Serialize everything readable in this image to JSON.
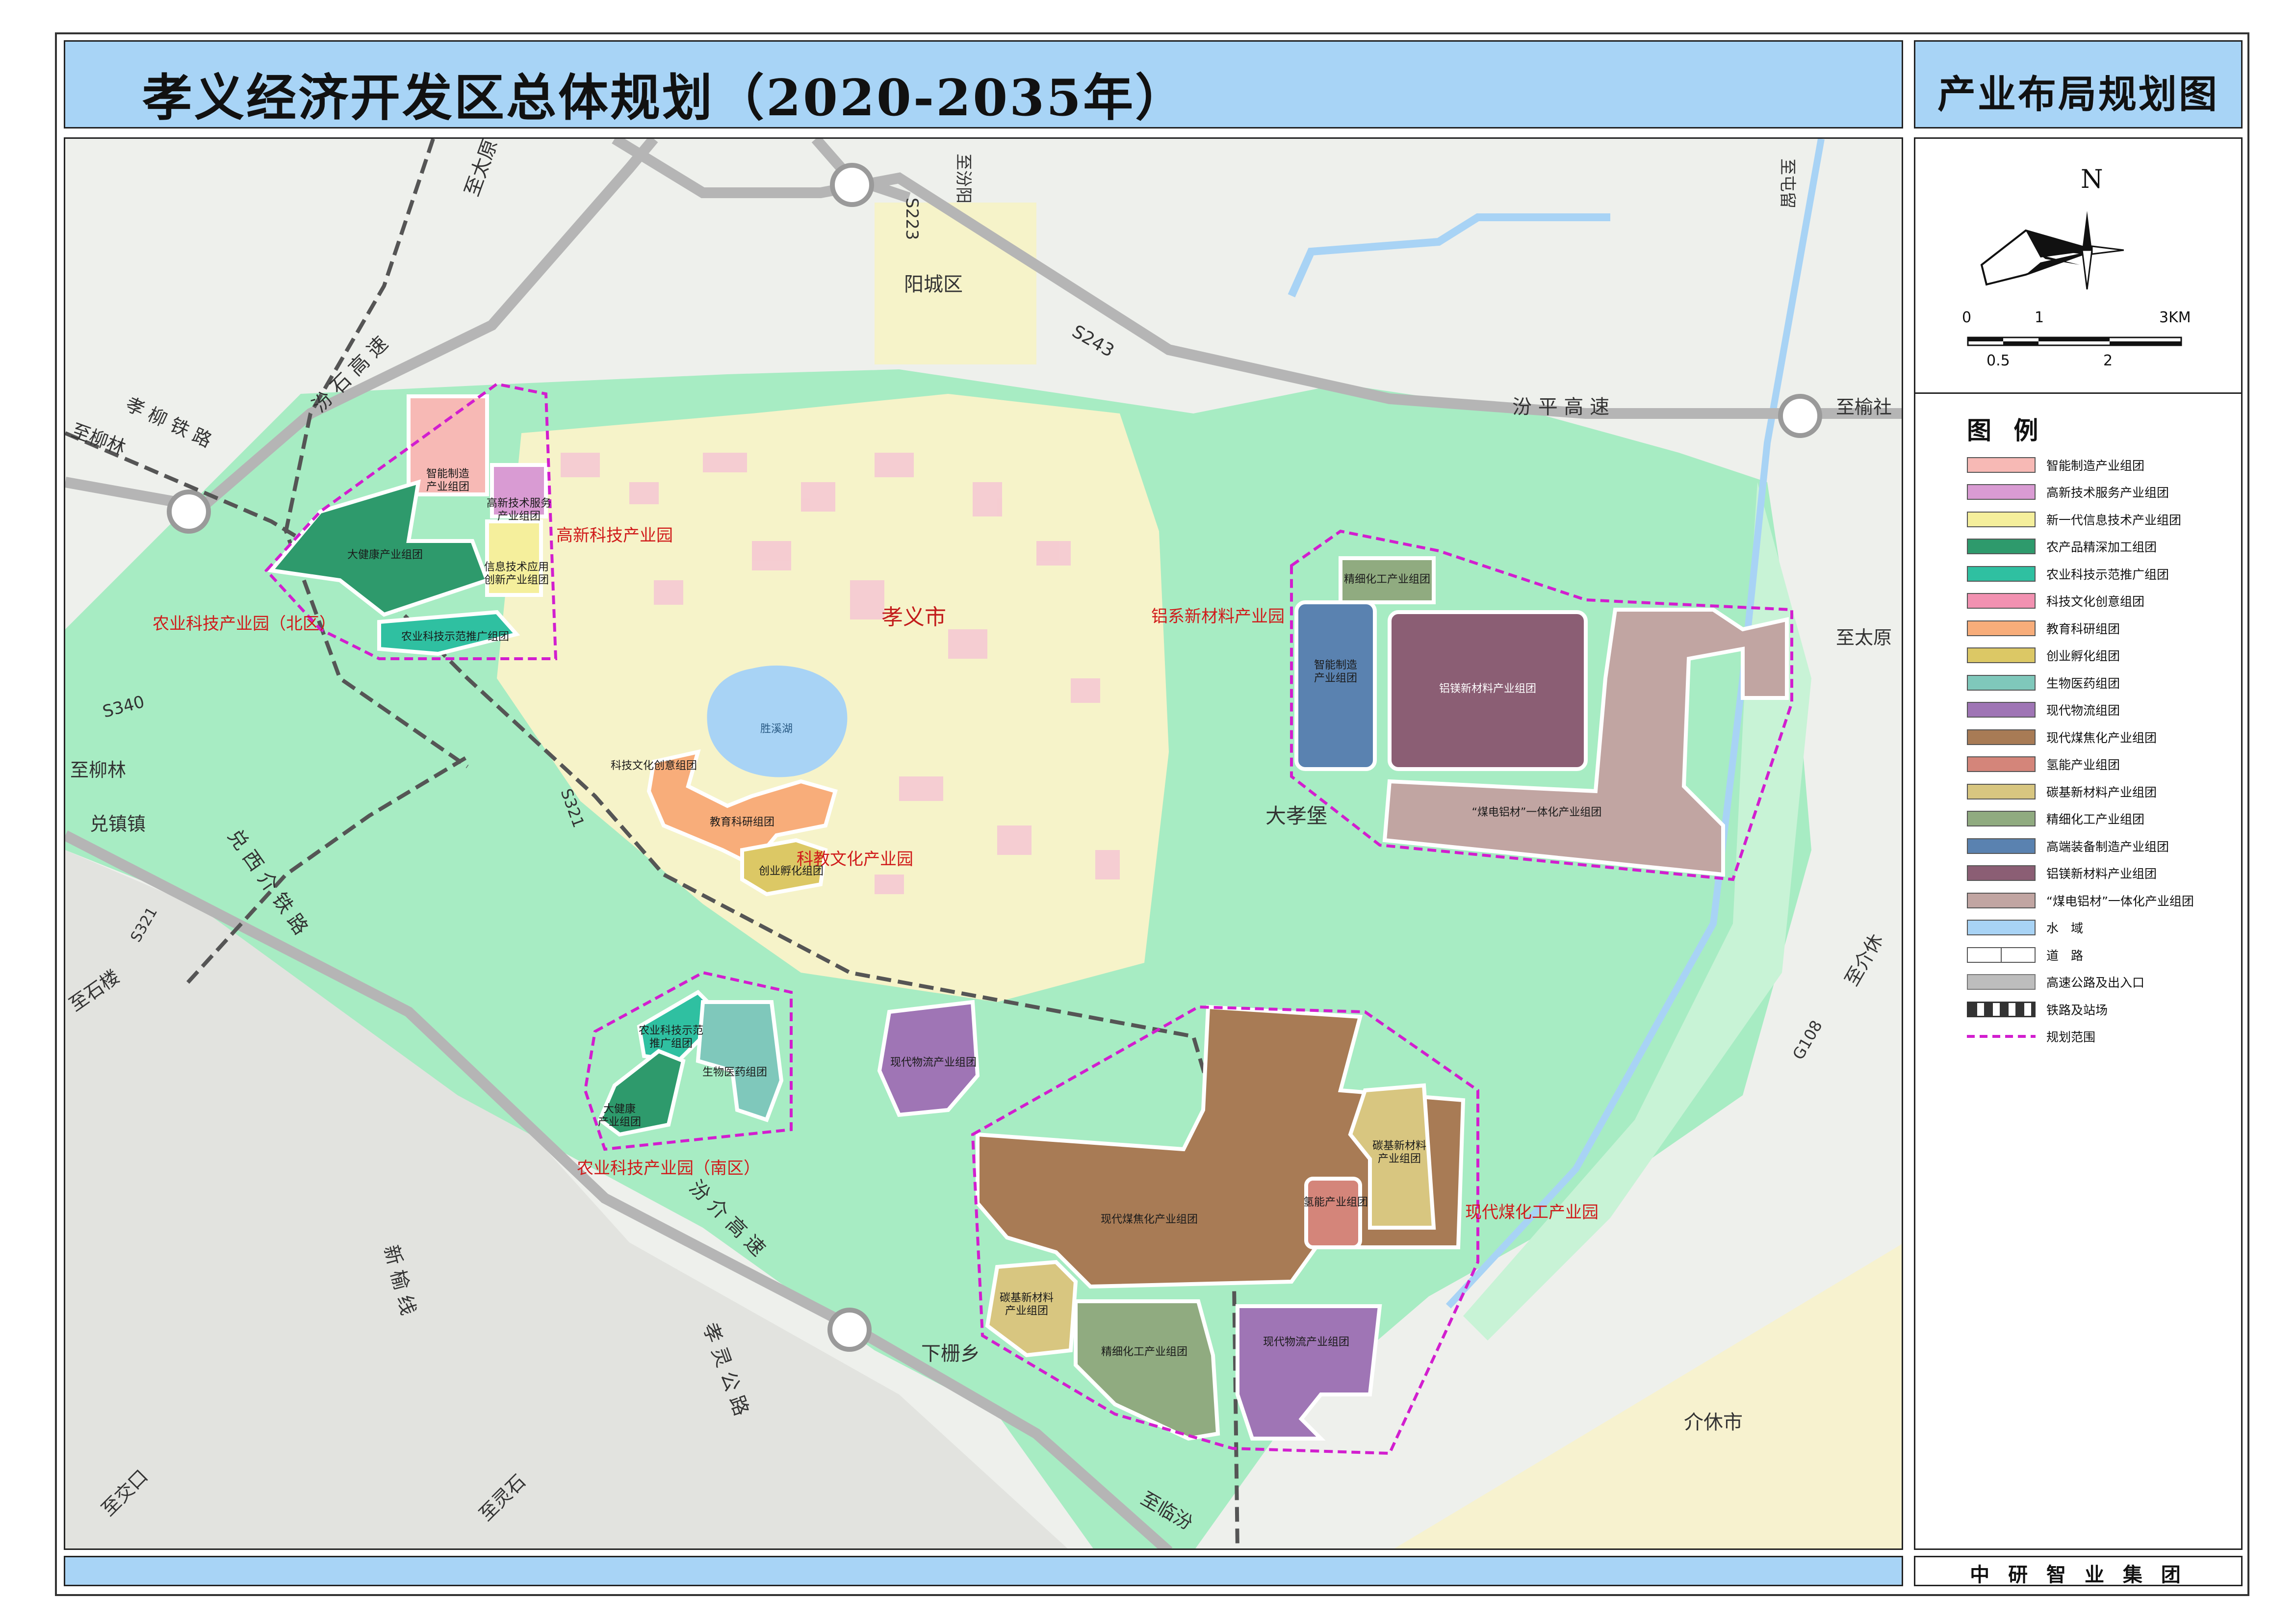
{
  "title": "孝义经济开发区总体规划（2020-2035年）",
  "sheet_title": "产业布局规划图",
  "organization": "中 研 智 业 集 团",
  "compass": {
    "north_label": "N"
  },
  "scale_bar": {
    "top_labels": [
      "0",
      "1",
      "3KM"
    ],
    "bottom_labels": [
      "0.5",
      "2"
    ]
  },
  "legend": {
    "title": "图 例",
    "items": [
      {
        "label": "智能制造产业组团",
        "color": "#f7b9b5"
      },
      {
        "label": "高新技术服务产业组团",
        "color": "#d99bd3"
      },
      {
        "label": "新一代信息技术产业组团",
        "color": "#f5ef9c"
      },
      {
        "label": "农产品精深加工组团",
        "color": "#2e9a6c"
      },
      {
        "label": "农业科技示范推广组团",
        "color": "#2fc0a1"
      },
      {
        "label": "科技文化创意组团",
        "color": "#f291b1"
      },
      {
        "label": "教育科研组团",
        "color": "#f8ad7a"
      },
      {
        "label": "创业孵化组团",
        "color": "#dcc865"
      },
      {
        "label": "生物医药组团",
        "color": "#7fc8bb"
      },
      {
        "label": "现代物流组团",
        "color": "#9f75b5"
      },
      {
        "label": "现代煤焦化产业组团",
        "color": "#a87b55"
      },
      {
        "label": "氢能产业组团",
        "color": "#d4857a"
      },
      {
        "label": "碳基新材料产业组团",
        "color": "#d8c680"
      },
      {
        "label": "精细化工产业组团",
        "color": "#90ab80"
      },
      {
        "label": "高端装备制造产业组团",
        "color": "#5a82b0"
      },
      {
        "label": "铝镁新材料产业组团",
        "color": "#8b5e74"
      },
      {
        "label": "“煤电铝材”一体化产业组团",
        "color": "#c1a5a2"
      },
      {
        "label": "水　域",
        "color": "#a8d3f5"
      },
      {
        "label": "道　路",
        "color": "#ffffff"
      },
      {
        "label": "高速公路及出入口",
        "color": "#bdbdbd"
      },
      {
        "label": "铁路及站场",
        "color": "#ffffff"
      },
      {
        "label": "规划范围",
        "color": "#d21ecf"
      }
    ]
  },
  "map": {
    "places": {
      "xiaoyi_city": "孝义市",
      "yangcheng": "阳城区",
      "daxiaobao": "大孝堡",
      "xiashanxiang": "下栅乡",
      "jiexiu_city": "介休市",
      "shengxi_lake": "胜溪湖"
    },
    "parks": {
      "gaoxin": "高新科技产业园",
      "nongye_north": "农业科技产业园（北区）",
      "lvxi": "铝系新材料产业园",
      "kejiao": "科教文化产业园",
      "nongye_south": "农业科技产业园（南区）",
      "meihuagong": "现代煤化工产业园"
    },
    "clusters": {
      "zhineng_zhizao": "智能制造\n产业组团",
      "gaoxin_fuwu": "高新技术服务\n产业组团",
      "dajiankang_n": "大健康产业组团",
      "xinxi_jishu": "信息技术应用\n创新产业组团",
      "nongke_n": "农业科技示范推广组团",
      "jingxi_huagong_n": "精细化工产业组团",
      "zhineng_zhizao_e": "智能制造\n产业组团",
      "lvmei": "铝镁新材料产业组团",
      "meidian_lvcai": "“煤电铝材”一体化产业组团",
      "keji_wenhua": "科技文化创意组团",
      "jiaoyu_keyan": "教育科研组团",
      "chuangye_fuhua": "创业孵化组团",
      "nongke_s": "农业科技示范\n推广组团",
      "shengwu_yiyao": "生物医药组团",
      "dajiankang_s": "大健康\n产业组团",
      "wuliu_w": "现代物流产业组团",
      "meijiaohua": "现代煤焦化产业组团",
      "tanji_e": "碳基新材料\n产业组团",
      "qingneng": "氢能产业组团",
      "tanji_w": "碳基新材料\n产业组团",
      "jingxi_huagong_s": "精细化工产业组团",
      "wuliu_s": "现代物流产业组团"
    },
    "roads": {
      "zhi_taiyuan_nw": "至太原",
      "s223": "S223",
      "zhi_fenyang": "至汾阳",
      "s243": "S243",
      "zhi_tunliu": "至屯留",
      "fenshi": "汾 石 高 速",
      "xiaoliu": "孝 柳 铁 路",
      "zhi_liulin_n": "至柳林",
      "fenping": "汾 平 高 速",
      "zhi_yushe": "至榆社",
      "zhi_taiyuan_e": "至太原",
      "s340": "S340",
      "zhi_liulin_w": "至柳林",
      "duizhen": "兑镇镇",
      "dui_xi_jie": "兑 西 介 铁 路",
      "s321_w": "S321",
      "s321_c": "S321",
      "zhi_shilou": "至石楼",
      "zhi_jiexiu": "至介休",
      "g108": "G108",
      "fenjie": "汾 介 高 速",
      "xinyu": "新 榆 线",
      "xiaolinggong": "孝 灵 公 路",
      "zhi_jiaokou": "至交口",
      "zhi_lingshi": "至灵石",
      "zhi_linfen": "至临汾"
    }
  }
}
